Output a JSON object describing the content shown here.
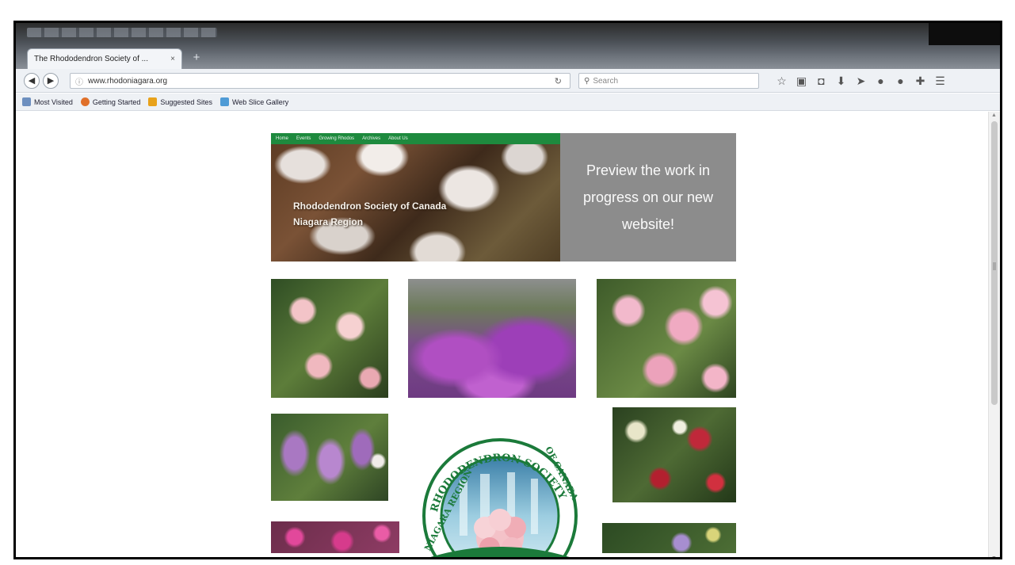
{
  "browser": {
    "tab_title": "The Rhododendron Society of ...",
    "tab_close": "×",
    "new_tab": "+",
    "url": "www.rhodoniagara.org",
    "search_placeholder": "Search",
    "bookmarks": [
      {
        "label": "Most Visited",
        "icon": "folder-icon"
      },
      {
        "label": "Getting Started",
        "icon": "firefox-icon"
      },
      {
        "label": "Suggested Sites",
        "icon": "suggested-sites-icon"
      },
      {
        "label": "Web Slice Gallery",
        "icon": "web-slice-icon"
      }
    ],
    "toolbar_icons": [
      "star-icon",
      "clipboard-icon",
      "pocket-icon",
      "download-icon",
      "send-icon",
      "addon-icon",
      "addon2-icon",
      "extension-icon",
      "menu-icon"
    ]
  },
  "site": {
    "nav": [
      "Home",
      "Events",
      "Growing Rhodos",
      "Archives",
      "About Us"
    ],
    "hero_title_line1": "Rhododendron Society of Canada",
    "hero_title_line2": "Niagara Region",
    "preview_text": "Preview the work in progress on our new website!",
    "logo_top": "RHODODENDRON SOCIETY",
    "logo_left": "NIAGARA REGION",
    "logo_right": "OF CANADA"
  }
}
